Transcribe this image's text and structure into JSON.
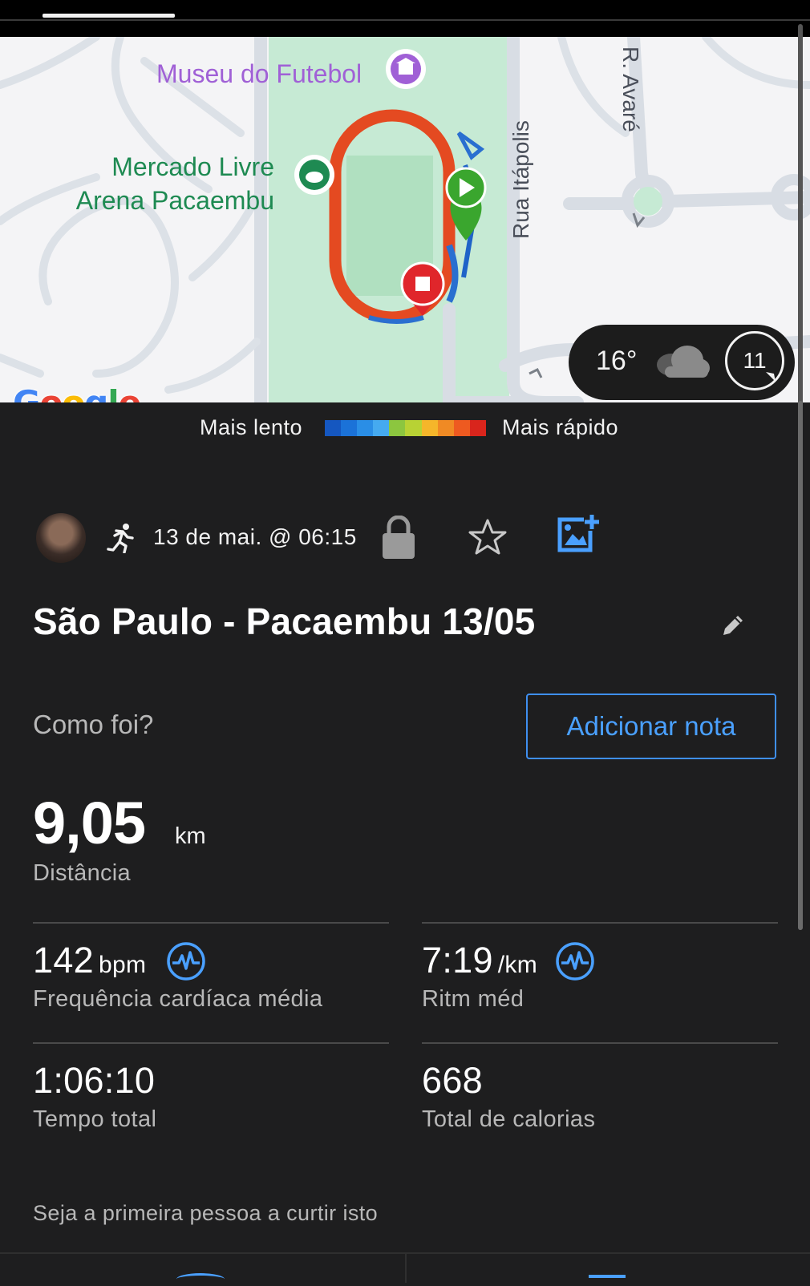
{
  "map": {
    "poi_museu": "Museu do Futebol",
    "poi_arena_line1": "Mercado Livre",
    "poi_arena_line2": "Arena Pacaembu",
    "street_itapolis": "Rua Itápolis",
    "street_avare": "R. Avaré",
    "google": [
      "G",
      "o",
      "o",
      "g",
      "l",
      "e"
    ],
    "google_colors": [
      "#4285f4",
      "#ea4335",
      "#fbbc05",
      "#4285f4",
      "#34a853",
      "#ea4335"
    ],
    "weather_temp": "16°",
    "weather_icon": "cloud-icon",
    "wind_speed": "11"
  },
  "pace_legend": {
    "slow": "Mais lento",
    "fast": "Mais rápido",
    "colors": [
      "#1557c0",
      "#1b72d8",
      "#2a8ee6",
      "#45aaf0",
      "#8cc63f",
      "#b8d234",
      "#f5b62a",
      "#f08a24",
      "#ee5a20",
      "#d9251c"
    ]
  },
  "activity": {
    "icon": "running-icon",
    "date": "13 de mai. @ 06:15",
    "title": "São Paulo - Pacaembu 13/05",
    "how_prompt": "Como foi?",
    "add_note": "Adicionar nota"
  },
  "distance": {
    "value": "9,05",
    "unit": "km",
    "label": "Distância"
  },
  "stats": {
    "hr_value": "142",
    "hr_unit": "bpm",
    "hr_label": "Frequência cardíaca média",
    "pace_value": "7:19",
    "pace_unit": "/km",
    "pace_label": "Ritm méd",
    "time_value": "1:06:10",
    "time_label": "Tempo total",
    "cal_value": "668",
    "cal_label": "Total de calorias"
  },
  "social": {
    "likes": "Seja a primeira pessoa a curtir isto"
  },
  "colors": {
    "accent": "#4aa0ff",
    "background": "#1e1e1f",
    "start_marker": "#3aa62e",
    "stop_marker": "#e0262b"
  }
}
